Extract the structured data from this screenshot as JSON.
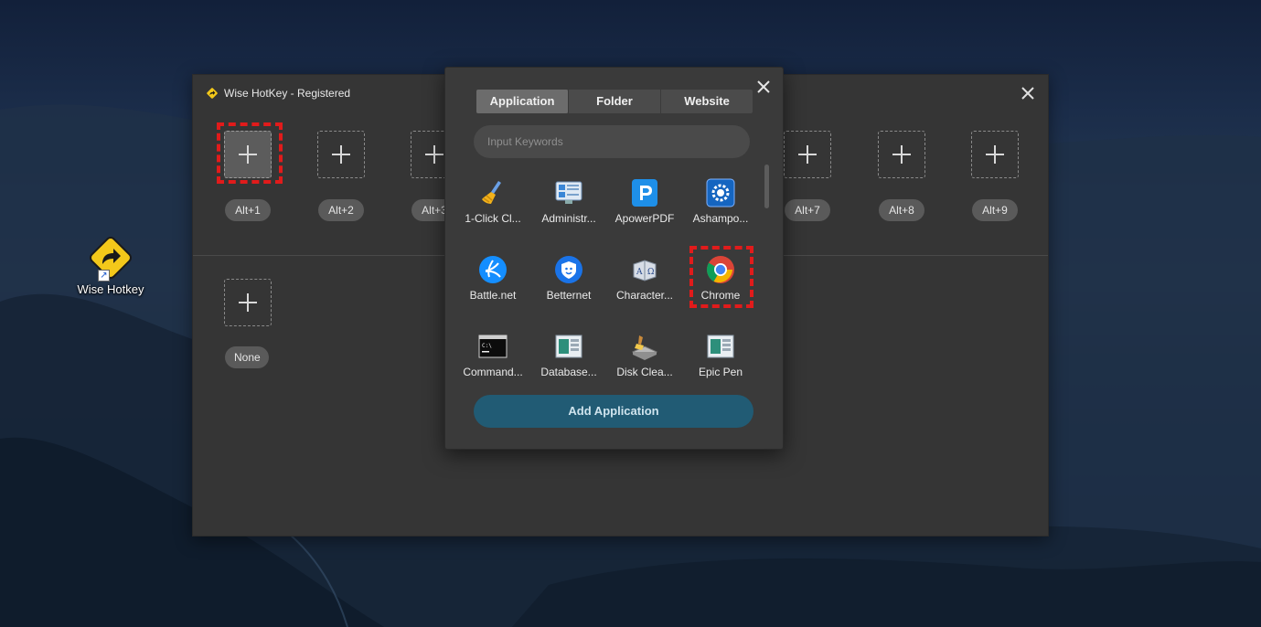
{
  "desktop": {
    "icon_label": "Wise Hotkey",
    "icon_name": "wise-hotkey-icon"
  },
  "main_window": {
    "title": "Wise HotKey - Registered",
    "hotkey_slots": [
      {
        "label": "Alt+1",
        "active": true
      },
      {
        "label": "Alt+2"
      },
      {
        "label": "Alt+3"
      },
      {
        "label": "Alt+7"
      },
      {
        "label": "Alt+8"
      },
      {
        "label": "Alt+9"
      }
    ],
    "extra_slot_label": "None"
  },
  "popup": {
    "tabs": [
      {
        "label": "Application",
        "selected": true
      },
      {
        "label": "Folder"
      },
      {
        "label": "Website"
      }
    ],
    "search_placeholder": "Input Keywords",
    "apps": [
      {
        "name": "1-Click Cl...",
        "icon": "broom-icon"
      },
      {
        "name": "Administr...",
        "icon": "admin-tools-icon"
      },
      {
        "name": "ApowerPDF",
        "icon": "apowerpdf-icon"
      },
      {
        "name": "Ashampo...",
        "icon": "ashampoo-gear-icon"
      },
      {
        "name": "Battle.net",
        "icon": "battlenet-icon"
      },
      {
        "name": "Betternet",
        "icon": "betternet-icon"
      },
      {
        "name": "Character...",
        "icon": "character-map-icon"
      },
      {
        "name": "Chrome",
        "icon": "chrome-icon",
        "highlighted": true
      },
      {
        "name": "Command...",
        "icon": "command-prompt-icon"
      },
      {
        "name": "Database...",
        "icon": "database-icon"
      },
      {
        "name": "Disk Clea...",
        "icon": "disk-cleanup-icon"
      },
      {
        "name": "Epic Pen",
        "icon": "epic-pen-icon"
      }
    ],
    "add_button_label": "Add Application"
  },
  "colors": {
    "highlight": "#e11b1b",
    "add_button": "#215b74",
    "window_bg": "#353535"
  }
}
